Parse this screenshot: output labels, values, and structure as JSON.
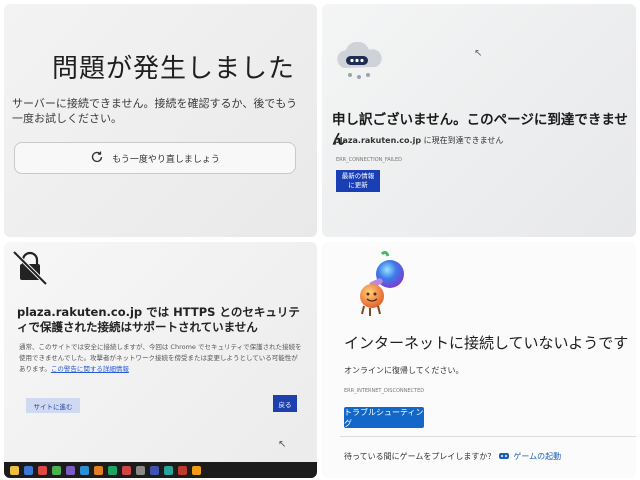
{
  "panel1": {
    "title": "問題が発生しました",
    "message": "サーバーに接続できません。接続を確認するか、後でもう一度お試しください。",
    "retry_label": "もう一度やり直しましょう"
  },
  "panel2": {
    "title": "申し訳ございません。このページに到達できません",
    "host": "plaza.rakuten.co.jp",
    "host_suffix": " に現在到達できません",
    "error_code": "ERR_CONNECTION_FAILED",
    "refresh_button_line1": "最新の情報",
    "refresh_button_line2": "に更新"
  },
  "panel3": {
    "title": "plaza.rakuten.co.jp では HTTPS とのセキュリティで保護された接続はサポートされていません",
    "body": "通常、このサイトでは安全に接続しますが、今回は Chrome でセキュリティで保護された接続を使用できませんでした。攻撃者がネットワーク接続を傍受または変更しようとしている可能性があります。",
    "link_text": "この警告に関する詳細情報",
    "back_button": "サイトに進む",
    "close_button": "戻る"
  },
  "panel4": {
    "title": "インターネットに接続していないようです",
    "subtitle": "オンラインに復帰してください。",
    "error_code": "ERR_INTERNET_DISCONNECTED",
    "troubleshoot_button": "トラブルシューティング",
    "game_prompt": "待っている間にゲームをプレイしますか？",
    "game_link": "ゲームの起動"
  }
}
